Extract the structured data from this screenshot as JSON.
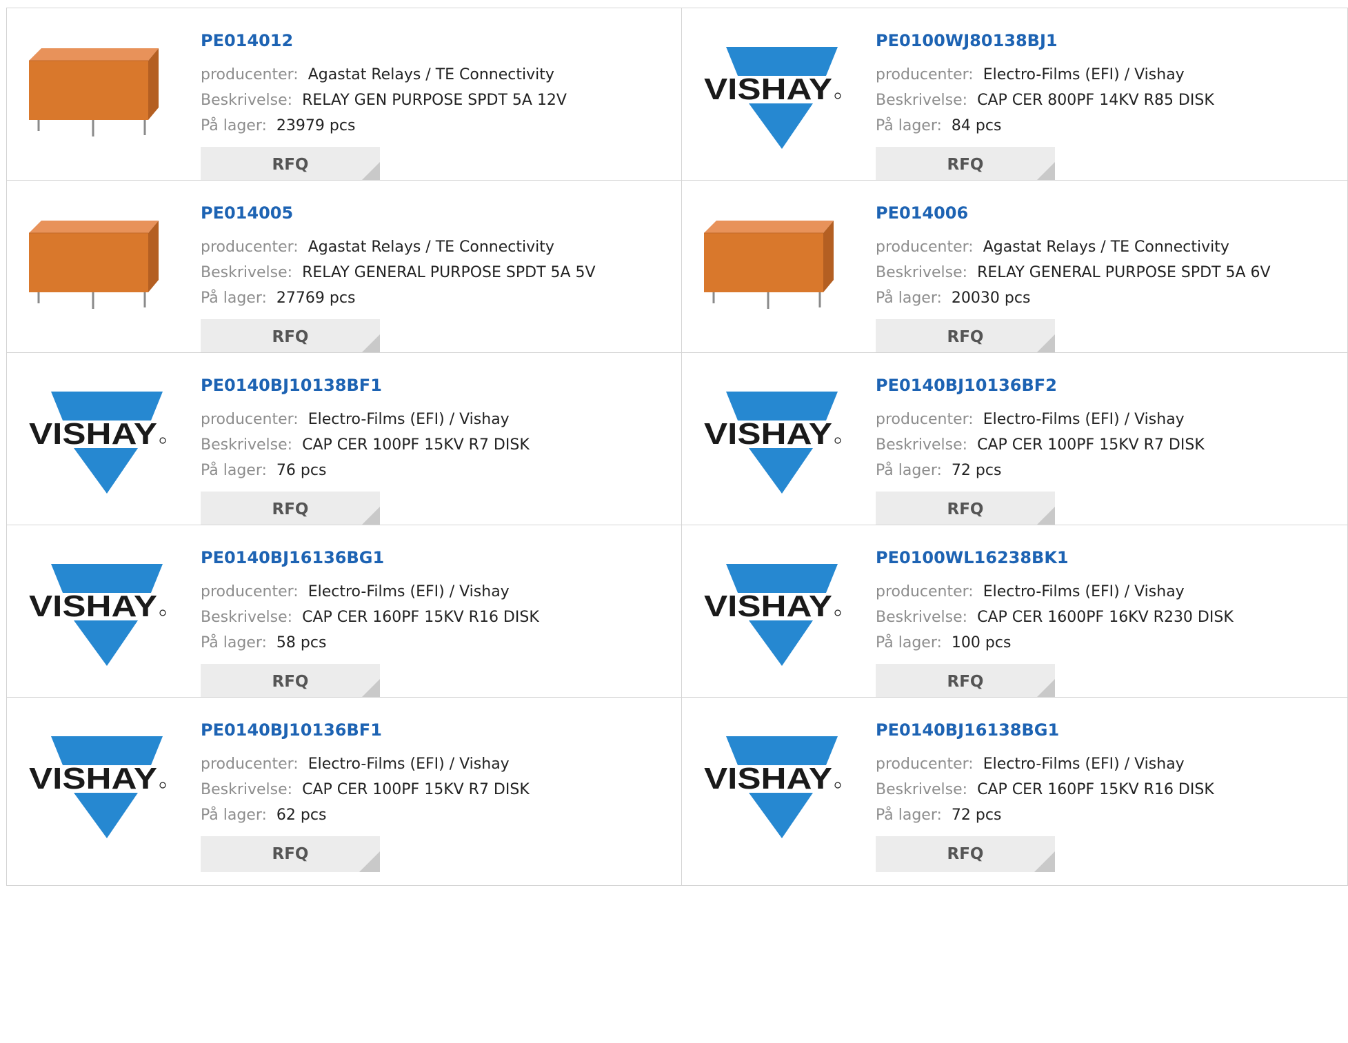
{
  "labels": {
    "manufacturer": "producenter:",
    "description": "Beskrivelse:",
    "stock": "På lager:",
    "rfq": "RFQ"
  },
  "logo_text": "VISHAY",
  "colors": {
    "title_link": "#1d63b3",
    "vishay_blue": "#2688d1",
    "relay_orange": "#d9782c"
  },
  "products": [
    {
      "part": "PE014012",
      "manufacturer": "Agastat Relays / TE Connectivity",
      "description": "RELAY GEN PURPOSE SPDT 5A 12V",
      "stock": "23979 pcs",
      "image": "relay"
    },
    {
      "part": "PE0100WJ80138BJ1",
      "manufacturer": "Electro-Films (EFI) / Vishay",
      "description": "CAP CER 800PF 14KV R85 DISK",
      "stock": "84 pcs",
      "image": "vishay-logo"
    },
    {
      "part": "PE014005",
      "manufacturer": "Agastat Relays / TE Connectivity",
      "description": "RELAY GENERAL PURPOSE SPDT 5A 5V",
      "stock": "27769 pcs",
      "image": "relay"
    },
    {
      "part": "PE014006",
      "manufacturer": "Agastat Relays / TE Connectivity",
      "description": "RELAY GENERAL PURPOSE SPDT 5A 6V",
      "stock": "20030 pcs",
      "image": "relay"
    },
    {
      "part": "PE0140BJ10138BF1",
      "manufacturer": "Electro-Films (EFI) / Vishay",
      "description": "CAP CER 100PF 15KV R7 DISK",
      "stock": "76 pcs",
      "image": "vishay-logo"
    },
    {
      "part": "PE0140BJ10136BF2",
      "manufacturer": "Electro-Films (EFI) / Vishay",
      "description": "CAP CER 100PF 15KV R7 DISK",
      "stock": "72 pcs",
      "image": "vishay-logo"
    },
    {
      "part": "PE0140BJ16136BG1",
      "manufacturer": "Electro-Films (EFI) / Vishay",
      "description": "CAP CER 160PF 15KV R16 DISK",
      "stock": "58 pcs",
      "image": "vishay-logo"
    },
    {
      "part": "PE0100WL16238BK1",
      "manufacturer": "Electro-Films (EFI) / Vishay",
      "description": "CAP CER 1600PF 16KV R230 DISK",
      "stock": "100 pcs",
      "image": "vishay-logo"
    },
    {
      "part": "PE0140BJ10136BF1",
      "manufacturer": "Electro-Films (EFI) / Vishay",
      "description": "CAP CER 100PF 15KV R7 DISK",
      "stock": "62 pcs",
      "image": "vishay-logo"
    },
    {
      "part": "PE0140BJ16138BG1",
      "manufacturer": "Electro-Films (EFI) / Vishay",
      "description": "CAP CER 160PF 15KV R16 DISK",
      "stock": "72 pcs",
      "image": "vishay-logo"
    }
  ]
}
